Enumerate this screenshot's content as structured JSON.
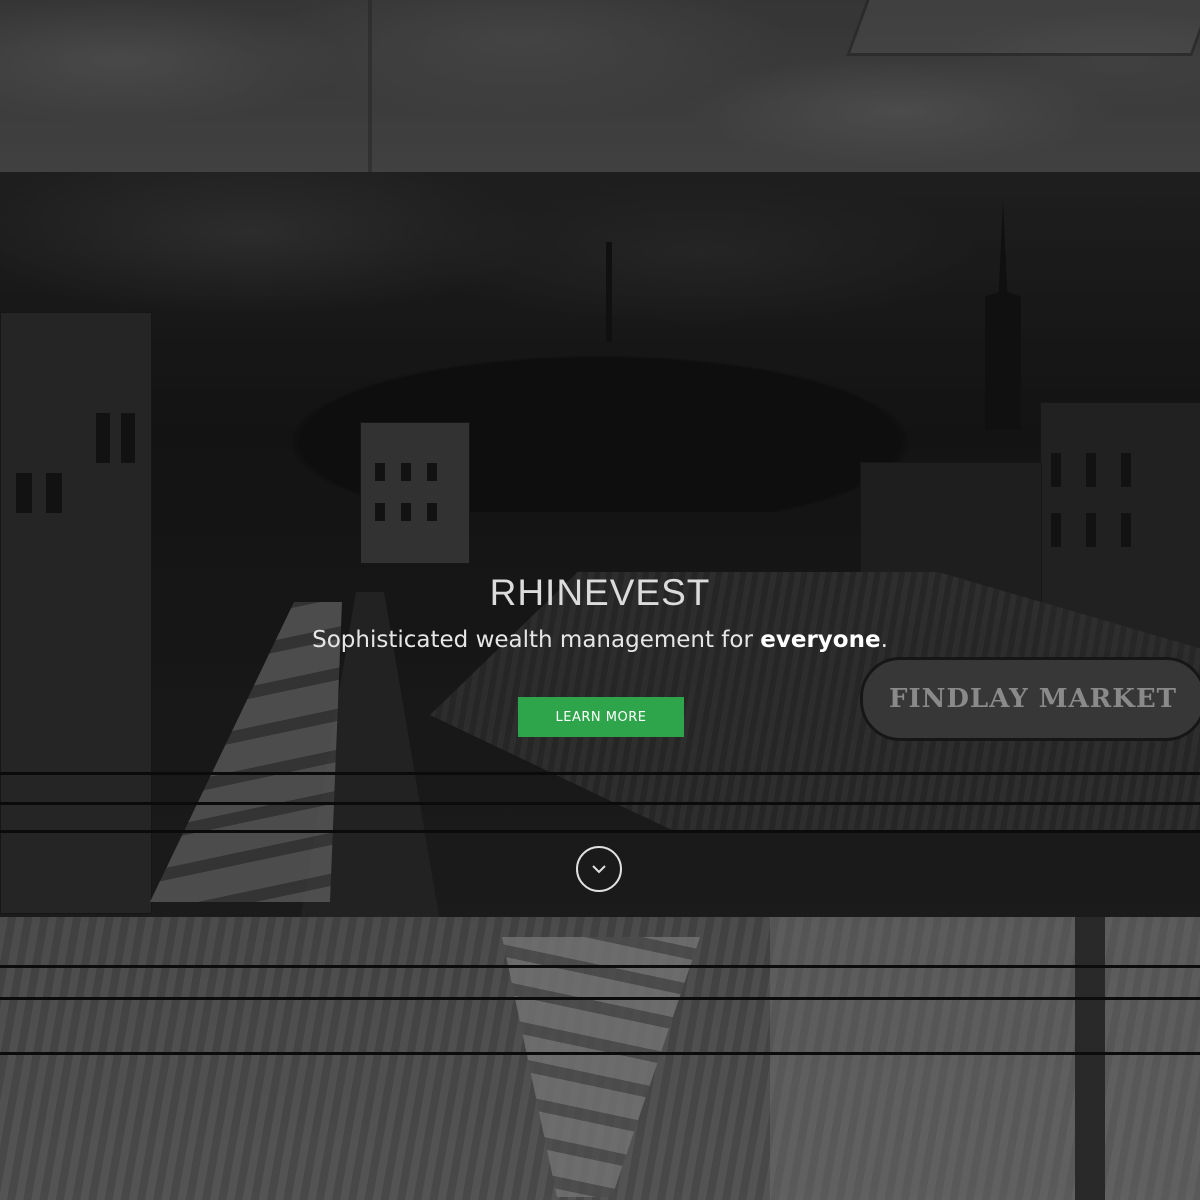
{
  "hero": {
    "brand": "RHINEVEST",
    "tagline_prefix": "Sophisticated wealth management for ",
    "tagline_emphasis": "everyone",
    "tagline_suffix": ".",
    "cta_label": "LEARN MORE",
    "scroll_icon": "chevron-down-icon"
  },
  "background": {
    "sign_text": "FINDLAY MARKET"
  },
  "colors": {
    "accent": "#2ea44b",
    "overlay": "#1e1e1e",
    "text": "#e6e6e6"
  }
}
